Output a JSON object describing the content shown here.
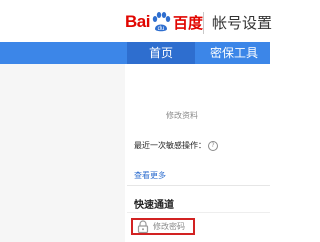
{
  "header": {
    "logo_bai": "Bai",
    "logo_du": "du",
    "logo_cn": "百度",
    "page_title": "帐号设置"
  },
  "nav": {
    "tabs": [
      {
        "label": "首页",
        "active": true
      },
      {
        "label": "密保工具",
        "active": false
      }
    ]
  },
  "main": {
    "edit_profile": "修改资料",
    "last_sensitive": "最近一次敏感操作：",
    "help_icon": "?",
    "view_more": "查看更多",
    "quick_title": "快速通道",
    "change_password": "修改密码"
  },
  "colors": {
    "brand_red": "#e10601",
    "nav_blue": "#3c86e8",
    "active_tab": "#2e6ecf",
    "highlight_border": "#d22222"
  }
}
